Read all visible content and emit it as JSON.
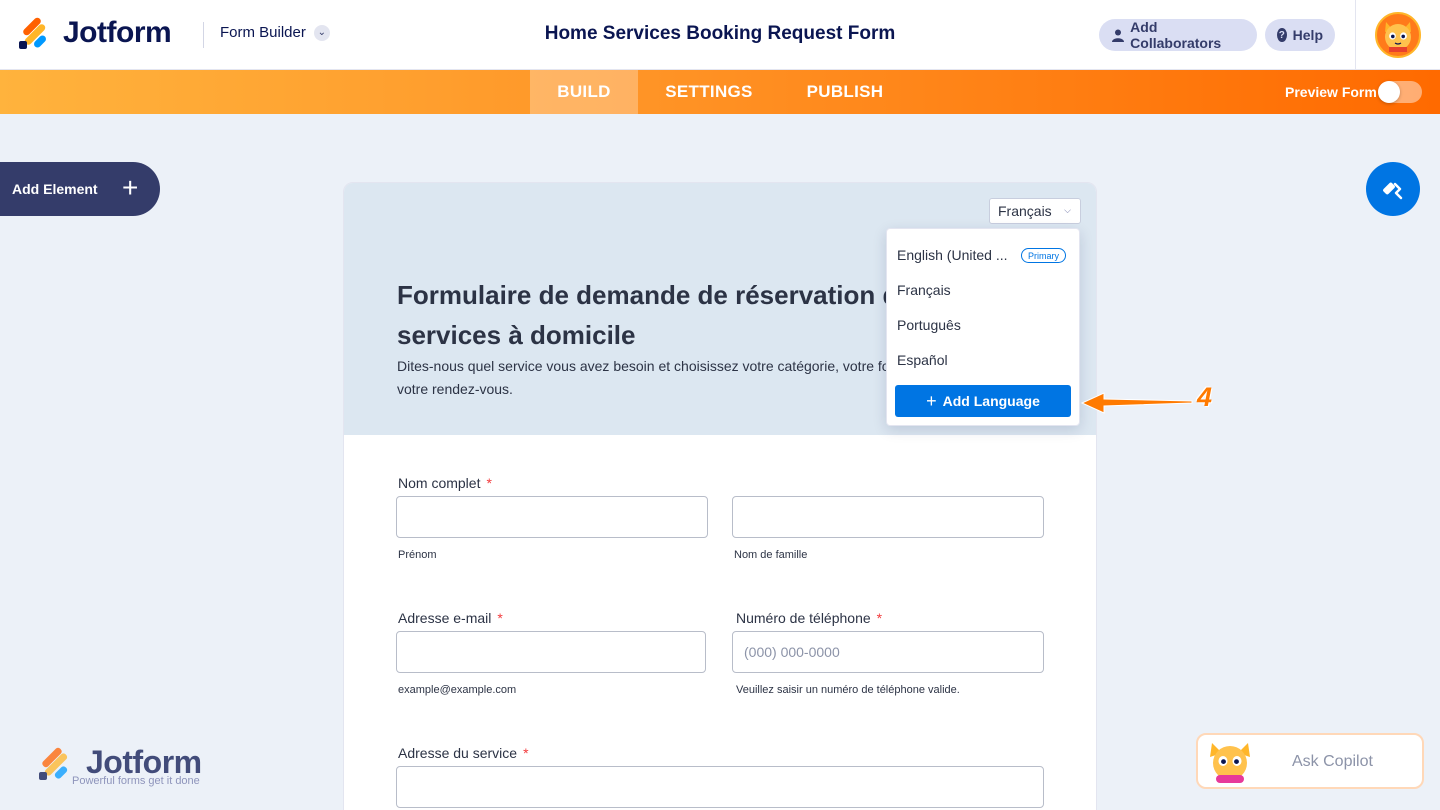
{
  "app": {
    "logo_text": "Jotform",
    "builder_label": "Form Builder",
    "form_title": "Home Services Booking Request Form",
    "collaborators_label": "Add Collaborators",
    "help_label": "Help"
  },
  "nav": {
    "tabs": [
      {
        "label": "BUILD",
        "active": true
      },
      {
        "label": "SETTINGS",
        "active": false
      },
      {
        "label": "PUBLISH",
        "active": false
      }
    ],
    "preview_label": "Preview Form",
    "preview_enabled": false
  },
  "sidebar": {
    "add_element_label": "Add Element"
  },
  "form": {
    "language_selected": "Français",
    "heading_line1": "Formulaire de demande de réservation de",
    "heading_line2": "services à domicile",
    "description_line1": "Dites-nous quel service vous avez besoin et choisissez votre catégorie, votre formule et",
    "description_line2": "votre rendez-vous.",
    "fields": {
      "full_name": {
        "label": "Nom complet",
        "required_mark": "*",
        "first_sublabel": "Prénom",
        "last_sublabel": "Nom de famille"
      },
      "email": {
        "label": "Adresse e-mail",
        "required_mark": "*",
        "sublabel": "example@example.com"
      },
      "phone": {
        "label": "Numéro de téléphone",
        "required_mark": "*",
        "placeholder": "(000) 000-0000",
        "sublabel": "Veuillez saisir un numéro de téléphone valide."
      },
      "service_address": {
        "label": "Adresse du service",
        "required_mark": "*"
      }
    }
  },
  "language_dropdown": {
    "items": [
      {
        "label": "English (United ...",
        "badge": "Primary"
      },
      {
        "label": "Français"
      },
      {
        "label": "Português"
      },
      {
        "label": "Español"
      }
    ],
    "add_language_label": "Add Language"
  },
  "annotation": {
    "step_number": "4",
    "color": "#FF7A00"
  },
  "footer": {
    "watermark_logo": "Jotform",
    "watermark_tagline": "Powerful forms get it done",
    "copilot_label": "Ask Copilot"
  },
  "colors": {
    "brand_orange": "#FF6100",
    "brand_blue": "#0075E3",
    "navy": "#0A1551"
  }
}
